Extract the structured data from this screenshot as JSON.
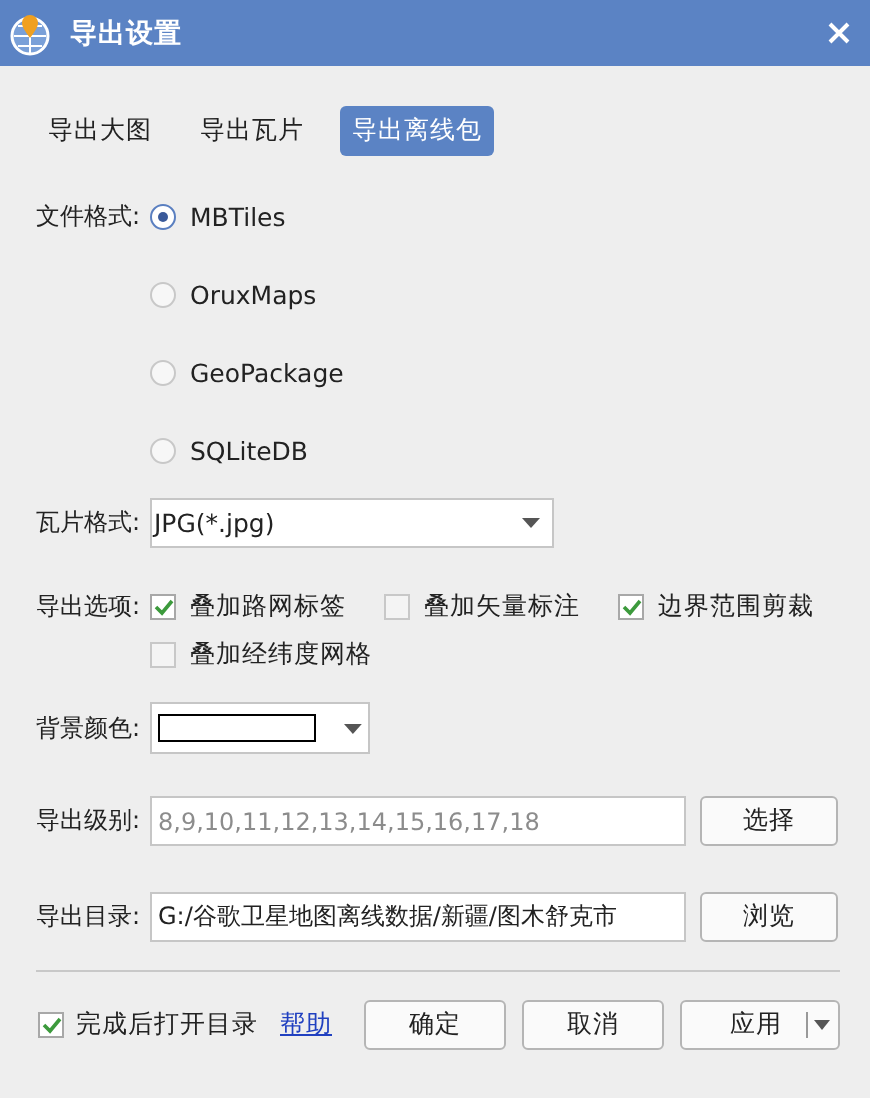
{
  "window": {
    "title": "导出设置"
  },
  "tabs": [
    {
      "label": "导出大图",
      "selected": false
    },
    {
      "label": "导出瓦片",
      "selected": false
    },
    {
      "label": "导出离线包",
      "selected": true
    }
  ],
  "file_format": {
    "label": "文件格式:",
    "options": [
      {
        "label": "MBTiles",
        "selected": true
      },
      {
        "label": "OruxMaps",
        "selected": false
      },
      {
        "label": "GeoPackage",
        "selected": false
      },
      {
        "label": "SQLiteDB",
        "selected": false
      }
    ]
  },
  "tile_format": {
    "label": "瓦片格式:",
    "value": "JPG(*.jpg)"
  },
  "export_options": {
    "label": "导出选项:",
    "options": [
      {
        "label": "叠加路网标签",
        "checked": true
      },
      {
        "label": "叠加矢量标注",
        "checked": false
      },
      {
        "label": "边界范围剪裁",
        "checked": true
      },
      {
        "label": "叠加经纬度网格",
        "checked": false
      }
    ]
  },
  "background_color": {
    "label": "背景颜色:",
    "color": "#ffffff"
  },
  "levels": {
    "label": "导出级别:",
    "value": "8,9,10,11,12,13,14,15,16,17,18",
    "readonly": true,
    "button": "选择"
  },
  "directory": {
    "label": "导出目录:",
    "value": "G:/谷歌卫星地图离线数据/新疆/图木舒克市",
    "readonly": false,
    "button": "浏览"
  },
  "footer": {
    "open_after": {
      "label": "完成后打开目录",
      "checked": true
    },
    "help_link": "帮助",
    "buttons": [
      {
        "label": "确定",
        "kind": "plain"
      },
      {
        "label": "取消",
        "kind": "plain"
      },
      {
        "label": "应用",
        "kind": "split"
      }
    ]
  }
}
